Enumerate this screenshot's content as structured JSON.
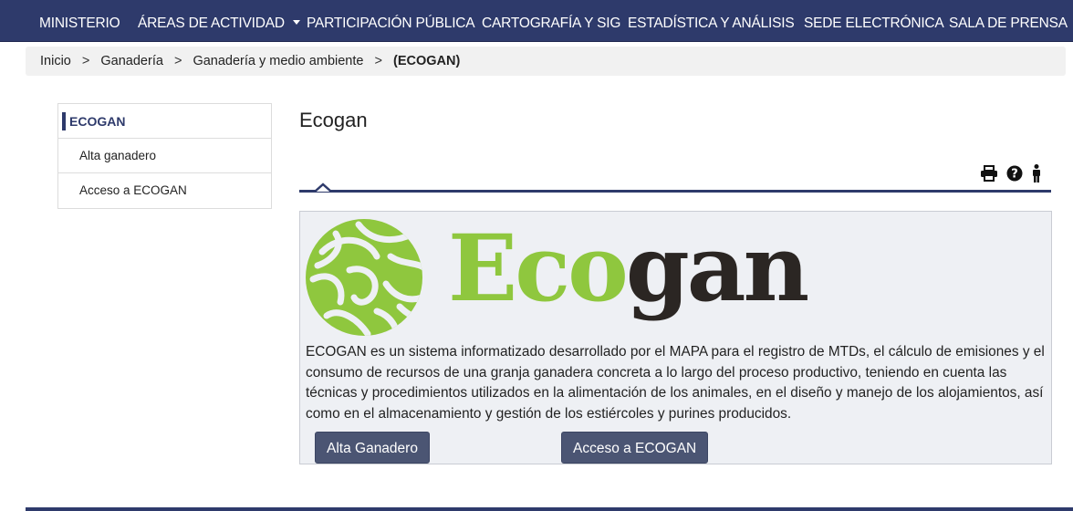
{
  "nav": {
    "items": [
      {
        "label": "MINISTERIO",
        "has_caret": false
      },
      {
        "label": "ÁREAS DE ACTIVIDAD",
        "has_caret": true
      },
      {
        "label": "PARTICIPACIÓN PÚBLICA",
        "has_caret": false
      },
      {
        "label": "CARTOGRAFÍA Y SIG",
        "has_caret": false
      },
      {
        "label": "ESTADÍSTICA Y ANÁLISIS",
        "has_caret": false
      },
      {
        "label": "SEDE ELECTRÓNICA",
        "has_caret": false
      },
      {
        "label": "SALA DE PRENSA",
        "has_caret": false
      }
    ]
  },
  "breadcrumb": {
    "items": [
      "Inicio",
      "Ganadería",
      "Ganadería y medio ambiente"
    ],
    "separator": ">",
    "current": "(ECOGAN)"
  },
  "sidebar": {
    "title": "ECOGAN",
    "items": [
      "Alta ganadero",
      "Acceso a ECOGAN"
    ]
  },
  "main": {
    "title": "Ecogan",
    "tools": [
      "print-icon",
      "help-icon",
      "accessibility-icon"
    ],
    "logo": {
      "part1": "Eco",
      "part2": "gan"
    },
    "description": "ECOGAN es un sistema informatizado desarrollado por el MAPA para el registro de MTDs, el cálculo de emisiones y el consumo de recursos de una granja ganadera concreta a lo largo del proceso productivo, teniendo en cuenta las técnicas y procedimientos utilizados en la alimentación de los animales, en el diseño y manejo de los alojamientos, así como en el almacenamiento y gestión de los estiércoles y purines producidos.",
    "buttons": {
      "alta": "Alta Ganadero",
      "acceso": "Acceso a ECOGAN"
    }
  },
  "colors": {
    "primary": "#2e3a6b",
    "button": "#4b5573",
    "logo_green": "#8fc73e",
    "logo_dark": "#2b2623",
    "panel_bg": "#eef0f4"
  }
}
